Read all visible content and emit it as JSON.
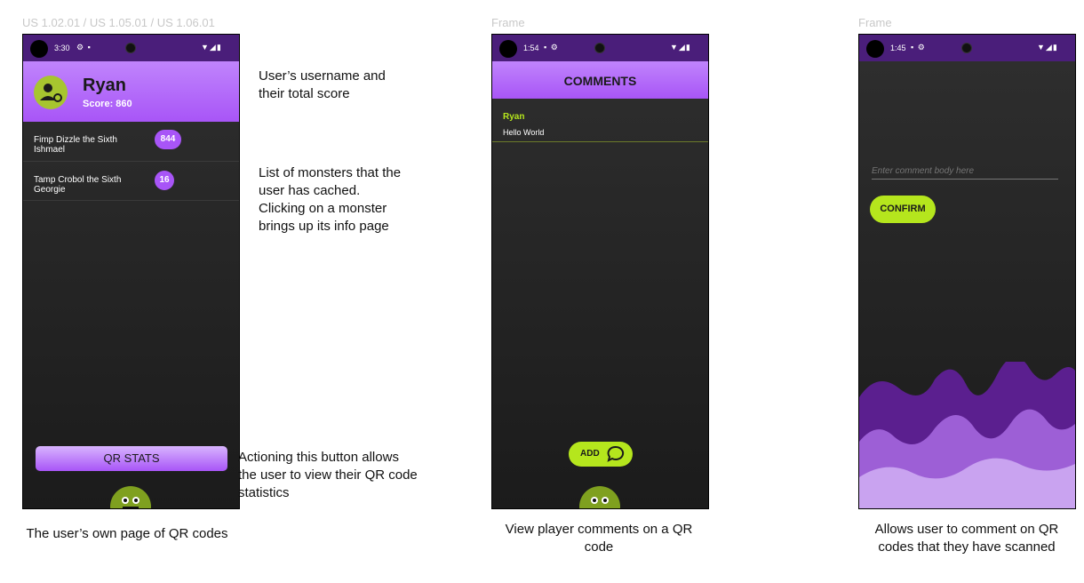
{
  "frames": {
    "frame1_label": "US 1.02.01 / US 1.05.01 / US 1.06.01",
    "frame2_label": "Frame",
    "frame3_label": "Frame"
  },
  "screen1": {
    "time": "3:30",
    "username": "Ryan",
    "score": "Score: 860",
    "monsters": [
      {
        "name_line1": "Fimp Dizzle the Sixth",
        "name_line2": "Ishmael",
        "score": "844"
      },
      {
        "name_line1": "Tamp Crobol the Sixth",
        "name_line2": "Georgie",
        "score": "16"
      }
    ],
    "qr_stats_label": "QR STATS"
  },
  "screen2": {
    "time": "1:54",
    "title": "COMMENTS",
    "comment_author": "Ryan",
    "comment_body": "Hello World",
    "add_label": "ADD"
  },
  "screen3": {
    "time": "1:45",
    "comment_placeholder": "Enter comment body here",
    "confirm_label": "CONFIRM"
  },
  "annotations": {
    "note_username_line1": "User’s username and",
    "note_username_line2": "their total score",
    "note_list_line1": "List of monsters that the",
    "note_list_line2": "user has cached.",
    "note_list_line3": "Clicking on a monster",
    "note_list_line4": "brings up its info page",
    "note_button_line1": "Actioning this button allows",
    "note_button_line2": "the user to view their QR code",
    "note_button_line3": "statistics"
  },
  "captions": {
    "caption1": "The user’s own page of QR codes",
    "caption2_line1": "View player comments on a QR",
    "caption2_line2": "code",
    "caption3_line1": "Allows user to comment on QR",
    "caption3_line2": "codes that they have scanned"
  },
  "colors": {
    "accent_purple": "#a855f7",
    "status_purple": "#4a1e7a",
    "accent_green": "#b5e61d"
  }
}
